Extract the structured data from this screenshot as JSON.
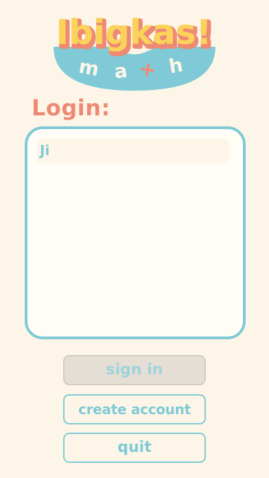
{
  "logo": {
    "title": "Ibigkas!",
    "subtitle_letters": [
      "m",
      "a",
      "+",
      "h"
    ]
  },
  "login": {
    "label": "Login:",
    "users": [
      "Ji"
    ]
  },
  "buttons": {
    "sign_in": "sign in",
    "create_account": "create account",
    "quit": "quit"
  },
  "colors": {
    "background": "#fdf6e8",
    "teal": "#7fcad6",
    "coral": "#ee8a74",
    "logo_yellow": "#fbd35b",
    "disabled_fill": "#e4ded4"
  }
}
